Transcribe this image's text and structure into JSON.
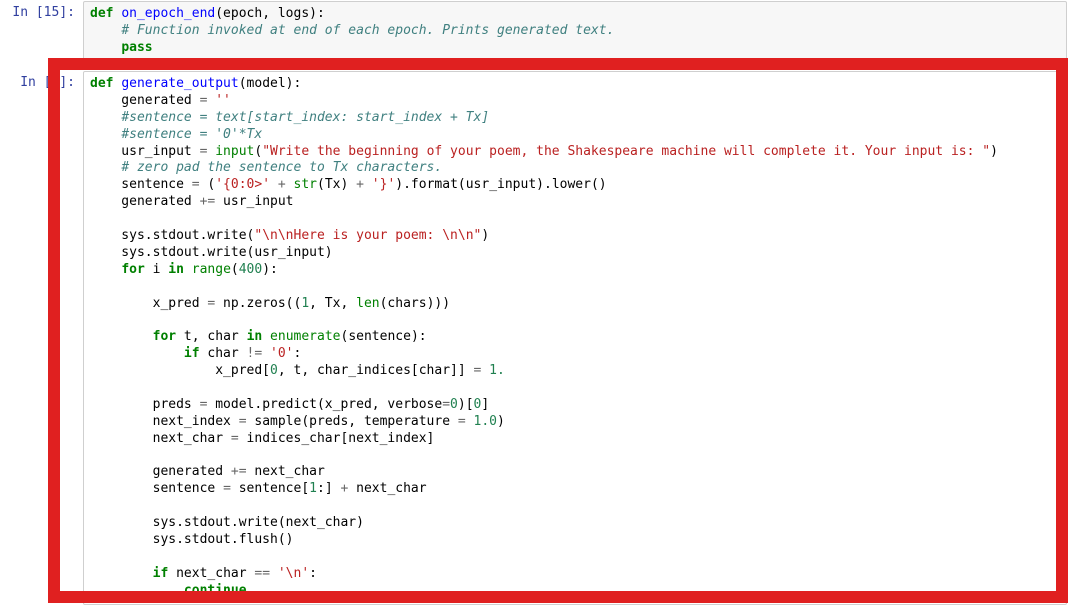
{
  "cells": [
    {
      "prompt": "In [15]:",
      "lines": [
        [
          [
            "kw",
            "def "
          ],
          [
            "def",
            "on_epoch_end"
          ],
          [
            "",
            "(epoch, logs):"
          ]
        ],
        [
          [
            "",
            "    "
          ],
          [
            "com",
            "# Function invoked at end of each epoch. Prints generated text."
          ]
        ],
        [
          [
            "",
            "    "
          ],
          [
            "kw",
            "pass"
          ]
        ]
      ]
    },
    {
      "prompt": "In [ ]:",
      "lines": [
        [
          [
            "kw",
            "def "
          ],
          [
            "def",
            "generate_output"
          ],
          [
            "",
            "(model):"
          ]
        ],
        [
          [
            "",
            "    generated "
          ],
          [
            "op",
            "="
          ],
          [
            "",
            " "
          ],
          [
            "str",
            "''"
          ]
        ],
        [
          [
            "",
            "    "
          ],
          [
            "com",
            "#sentence = text[start_index: start_index + Tx]"
          ]
        ],
        [
          [
            "",
            "    "
          ],
          [
            "com",
            "#sentence = '0'*Tx"
          ]
        ],
        [
          [
            "",
            "    usr_input "
          ],
          [
            "op",
            "="
          ],
          [
            "",
            " "
          ],
          [
            "bin",
            "input"
          ],
          [
            "",
            "("
          ],
          [
            "str",
            "\"Write the beginning of your poem, the Shakespeare machine will complete it. Your input is: \""
          ],
          [
            "",
            ")"
          ]
        ],
        [
          [
            "",
            "    "
          ],
          [
            "com",
            "# zero pad the sentence to Tx characters."
          ]
        ],
        [
          [
            "",
            "    sentence "
          ],
          [
            "op",
            "="
          ],
          [
            "",
            " ("
          ],
          [
            "str",
            "'{0:0>'"
          ],
          [
            "",
            " "
          ],
          [
            "op",
            "+"
          ],
          [
            "",
            " "
          ],
          [
            "bin",
            "str"
          ],
          [
            "",
            "(Tx) "
          ],
          [
            "op",
            "+"
          ],
          [
            "",
            " "
          ],
          [
            "str",
            "'}'"
          ],
          [
            "",
            ")"
          ],
          [
            "",
            ".format(usr_input)"
          ],
          [
            "",
            ".lower()"
          ]
        ],
        [
          [
            "",
            "    generated "
          ],
          [
            "op",
            "+="
          ],
          [
            "",
            " usr_input"
          ]
        ],
        [
          [
            "",
            ""
          ]
        ],
        [
          [
            "",
            "    sys.stdout.write("
          ],
          [
            "str",
            "\"\\n\\nHere is your poem: \\n\\n\""
          ],
          [
            "",
            ")"
          ]
        ],
        [
          [
            "",
            "    sys.stdout.write(usr_input)"
          ]
        ],
        [
          [
            "",
            "    "
          ],
          [
            "kw",
            "for"
          ],
          [
            "",
            " i "
          ],
          [
            "kw",
            "in"
          ],
          [
            "",
            " "
          ],
          [
            "bin",
            "range"
          ],
          [
            "",
            "("
          ],
          [
            "num",
            "400"
          ],
          [
            "",
            "):"
          ]
        ],
        [
          [
            "",
            ""
          ]
        ],
        [
          [
            "",
            "        x_pred "
          ],
          [
            "op",
            "="
          ],
          [
            "",
            " np.zeros(("
          ],
          [
            "num",
            "1"
          ],
          [
            "",
            ", Tx, "
          ],
          [
            "bin",
            "len"
          ],
          [
            "",
            "(chars)))"
          ]
        ],
        [
          [
            "",
            ""
          ]
        ],
        [
          [
            "",
            "        "
          ],
          [
            "kw",
            "for"
          ],
          [
            "",
            " t, char "
          ],
          [
            "kw",
            "in"
          ],
          [
            "",
            " "
          ],
          [
            "bin",
            "enumerate"
          ],
          [
            "",
            "(sentence):"
          ]
        ],
        [
          [
            "",
            "            "
          ],
          [
            "kw",
            "if"
          ],
          [
            "",
            " char "
          ],
          [
            "op",
            "!="
          ],
          [
            "",
            " "
          ],
          [
            "str",
            "'0'"
          ],
          [
            "",
            ":"
          ]
        ],
        [
          [
            "",
            "                x_pred["
          ],
          [
            "num",
            "0"
          ],
          [
            "",
            ", t, char_indices[char]] "
          ],
          [
            "op",
            "="
          ],
          [
            "",
            " "
          ],
          [
            "num",
            "1."
          ]
        ],
        [
          [
            "",
            ""
          ]
        ],
        [
          [
            "",
            "        preds "
          ],
          [
            "op",
            "="
          ],
          [
            "",
            " model.predict(x_pred, verbose"
          ],
          [
            "op",
            "="
          ],
          [
            "num",
            "0"
          ],
          [
            "",
            ")["
          ],
          [
            "num",
            "0"
          ],
          [
            "",
            "]"
          ]
        ],
        [
          [
            "",
            "        next_index "
          ],
          [
            "op",
            "="
          ],
          [
            "",
            " sample(preds, temperature "
          ],
          [
            "op",
            "="
          ],
          [
            "",
            " "
          ],
          [
            "num",
            "1.0"
          ],
          [
            "",
            ")"
          ]
        ],
        [
          [
            "",
            "        next_char "
          ],
          [
            "op",
            "="
          ],
          [
            "",
            " indices_char[next_index]"
          ]
        ],
        [
          [
            "",
            ""
          ]
        ],
        [
          [
            "",
            "        generated "
          ],
          [
            "op",
            "+="
          ],
          [
            "",
            " next_char"
          ]
        ],
        [
          [
            "",
            "        sentence "
          ],
          [
            "op",
            "="
          ],
          [
            "",
            " sentence["
          ],
          [
            "num",
            "1"
          ],
          [
            "",
            ":] "
          ],
          [
            "op",
            "+"
          ],
          [
            "",
            " next_char"
          ]
        ],
        [
          [
            "",
            ""
          ]
        ],
        [
          [
            "",
            "        sys.stdout.write(next_char)"
          ]
        ],
        [
          [
            "",
            "        sys.stdout.flush()"
          ]
        ],
        [
          [
            "",
            ""
          ]
        ],
        [
          [
            "",
            "        "
          ],
          [
            "kw",
            "if"
          ],
          [
            "",
            " next_char "
          ],
          [
            "op",
            "=="
          ],
          [
            "",
            " "
          ],
          [
            "str",
            "'\\n'"
          ],
          [
            "",
            ":"
          ]
        ],
        [
          [
            "",
            "            "
          ],
          [
            "kw",
            "continue"
          ]
        ]
      ]
    }
  ]
}
